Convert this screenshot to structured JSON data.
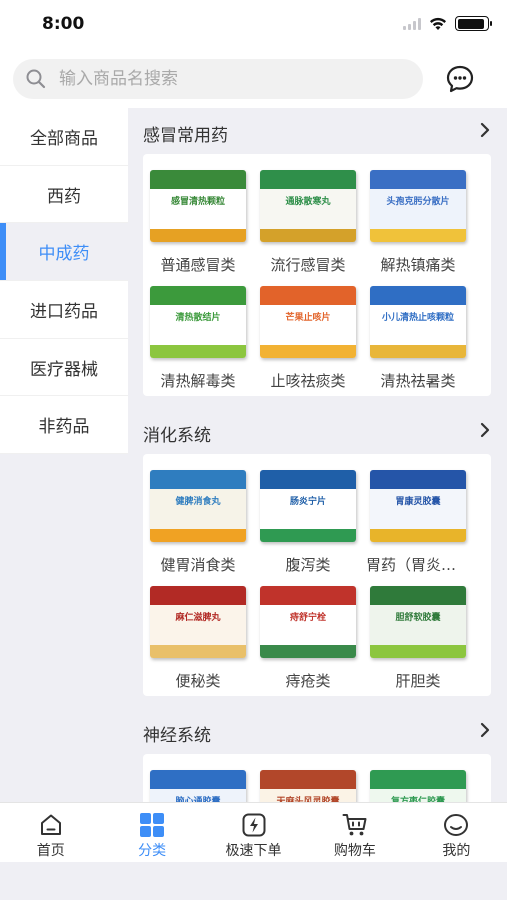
{
  "status": {
    "time": "8:00",
    "battery_level": 0.9
  },
  "search": {
    "placeholder": "输入商品名搜索",
    "value": ""
  },
  "sidebar": {
    "items": [
      {
        "label": "全部商品",
        "active": false
      },
      {
        "label": "西药",
        "active": false
      },
      {
        "label": "中成药",
        "active": true
      },
      {
        "label": "进口药品",
        "active": false
      },
      {
        "label": "医疗器械",
        "active": false
      },
      {
        "label": "非药品",
        "active": false
      }
    ]
  },
  "sections": [
    {
      "title": "感冒常用药",
      "items": [
        {
          "label": "普通感冒类",
          "box_text": "感冒清热颗粒",
          "colors": [
            "#ffffff",
            "#3a8a3a",
            "#e6a123"
          ]
        },
        {
          "label": "流行感冒类",
          "box_text": "通脉散寒丸",
          "colors": [
            "#f7f7f2",
            "#2f8f4a",
            "#d4a12a"
          ]
        },
        {
          "label": "解热镇痛类",
          "box_text": "头孢克肟分散片",
          "colors": [
            "#eef3fb",
            "#3a6fc4",
            "#f0c23a"
          ]
        },
        {
          "label": "清热解毒类",
          "box_text": "清热散结片",
          "colors": [
            "#ffffff",
            "#3c9a3c",
            "#8cc63f"
          ]
        },
        {
          "label": "止咳祛痰类",
          "box_text": "芒果止咳片",
          "colors": [
            "#ffffff",
            "#e2632a",
            "#f2b233"
          ]
        },
        {
          "label": "清热祛暑类",
          "box_text": "小儿清热止咳颗粒",
          "colors": [
            "#ffffff",
            "#2f6ec4",
            "#e8b63a"
          ]
        }
      ]
    },
    {
      "title": "消化系统",
      "items": [
        {
          "label": "健胃消食类",
          "box_text": "健脾消食丸",
          "colors": [
            "#f6f3e8",
            "#2f7dbf",
            "#f0a223"
          ]
        },
        {
          "label": "腹泻类",
          "box_text": "肠炎宁片",
          "colors": [
            "#ffffff",
            "#1f5fa8",
            "#2f9a52"
          ]
        },
        {
          "label": "胃药（胃炎、胃溃疡类）",
          "box_text": "胃康灵胶囊",
          "colors": [
            "#f3f6fb",
            "#2555a8",
            "#e8b42a"
          ]
        },
        {
          "label": "便秘类",
          "box_text": "麻仁滋脾丸",
          "colors": [
            "#fbf4ea",
            "#b22a25",
            "#e9c06a"
          ]
        },
        {
          "label": "痔疮类",
          "box_text": "痔舒宁栓",
          "colors": [
            "#ffffff",
            "#c0332b",
            "#3a8a4a"
          ]
        },
        {
          "label": "肝胆类",
          "box_text": "胆舒软胶囊",
          "colors": [
            "#eef4ec",
            "#2f7a3a",
            "#8cc63f"
          ]
        }
      ]
    },
    {
      "title": "神经系统",
      "items": [
        {
          "label": "",
          "box_text": "脑心通胶囊",
          "colors": [
            "#eef3fb",
            "#2f6fc4",
            "#9ac0ea"
          ]
        },
        {
          "label": "",
          "box_text": "天麻头风灵胶囊",
          "colors": [
            "#fbf3e6",
            "#b2472a",
            "#e8b45a"
          ]
        },
        {
          "label": "",
          "box_text": "复方枣仁胶囊",
          "colors": [
            "#eef8ee",
            "#2f9a52",
            "#8cd36f"
          ]
        }
      ]
    }
  ],
  "tabs": [
    {
      "label": "首页",
      "icon": "home-icon",
      "active": false
    },
    {
      "label": "分类",
      "icon": "category-icon",
      "active": true
    },
    {
      "label": "极速下单",
      "icon": "quick-order-icon",
      "active": false
    },
    {
      "label": "购物车",
      "icon": "cart-icon",
      "active": false
    },
    {
      "label": "我的",
      "icon": "profile-icon",
      "active": false
    }
  ],
  "accent_color": "#3e8ef7"
}
